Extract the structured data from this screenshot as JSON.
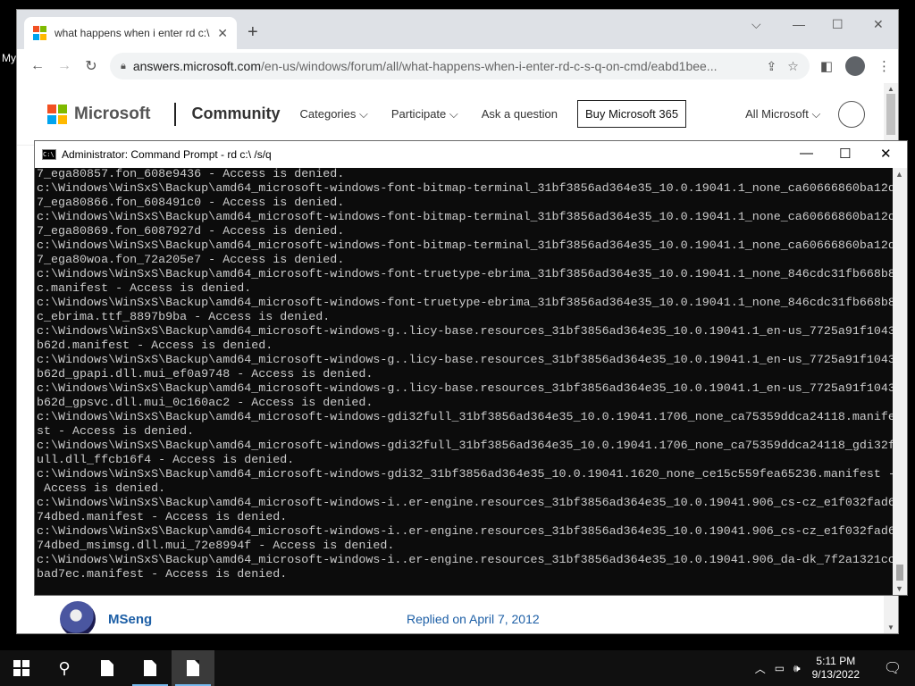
{
  "desktop": {
    "label": "My"
  },
  "browser": {
    "tab_title": "what happens when i enter rd c:\\",
    "tab_close": "✕",
    "new_tab": "+",
    "url_host": "answers.microsoft.com",
    "url_path": "/en-us/windows/forum/all/what-happens-when-i-enter-rd-c-s-q-on-cmd/eabd1bee...",
    "brand_colors": {
      "red": "#f25022",
      "green": "#7fba00",
      "blue": "#00a4ef",
      "yellow": "#ffb900"
    }
  },
  "page": {
    "logo_text": "Microsoft",
    "community": "Community",
    "menu": [
      "Categories ⌵",
      "Participate ⌵",
      "Ask a question"
    ],
    "buy_button": "Buy Microsoft 365",
    "all_microsoft": "All Microsoft ⌵",
    "reply": {
      "name": "MSeng",
      "date": "Replied on April 7, 2012"
    }
  },
  "cmd": {
    "title": "Administrator: Command Prompt - rd  c:\\ /s/q",
    "lines": [
      "7_ega80857.fon_608e9436 - Access is denied.",
      "c:\\Windows\\WinSxS\\Backup\\amd64_microsoft-windows-font-bitmap-terminal_31bf3856ad364e35_10.0.19041.1_none_ca60666860ba12d",
      "7_ega80866.fon_608491c0 - Access is denied.",
      "c:\\Windows\\WinSxS\\Backup\\amd64_microsoft-windows-font-bitmap-terminal_31bf3856ad364e35_10.0.19041.1_none_ca60666860ba12d",
      "7_ega80869.fon_6087927d - Access is denied.",
      "c:\\Windows\\WinSxS\\Backup\\amd64_microsoft-windows-font-bitmap-terminal_31bf3856ad364e35_10.0.19041.1_none_ca60666860ba12d",
      "7_ega80woa.fon_72a205e7 - Access is denied.",
      "c:\\Windows\\WinSxS\\Backup\\amd64_microsoft-windows-font-truetype-ebrima_31bf3856ad364e35_10.0.19041.1_none_846cdc31fb668b8",
      "c.manifest - Access is denied.",
      "c:\\Windows\\WinSxS\\Backup\\amd64_microsoft-windows-font-truetype-ebrima_31bf3856ad364e35_10.0.19041.1_none_846cdc31fb668b8",
      "c_ebrima.ttf_8897b9ba - Access is denied.",
      "c:\\Windows\\WinSxS\\Backup\\amd64_microsoft-windows-g..licy-base.resources_31bf3856ad364e35_10.0.19041.1_en-us_7725a91f1043",
      "b62d.manifest - Access is denied.",
      "c:\\Windows\\WinSxS\\Backup\\amd64_microsoft-windows-g..licy-base.resources_31bf3856ad364e35_10.0.19041.1_en-us_7725a91f1043",
      "b62d_gpapi.dll.mui_ef0a9748 - Access is denied.",
      "c:\\Windows\\WinSxS\\Backup\\amd64_microsoft-windows-g..licy-base.resources_31bf3856ad364e35_10.0.19041.1_en-us_7725a91f1043",
      "b62d_gpsvc.dll.mui_0c160ac2 - Access is denied.",
      "c:\\Windows\\WinSxS\\Backup\\amd64_microsoft-windows-gdi32full_31bf3856ad364e35_10.0.19041.1706_none_ca75359ddca24118.manife",
      "st - Access is denied.",
      "c:\\Windows\\WinSxS\\Backup\\amd64_microsoft-windows-gdi32full_31bf3856ad364e35_10.0.19041.1706_none_ca75359ddca24118_gdi32f",
      "ull.dll_ffcb16f4 - Access is denied.",
      "c:\\Windows\\WinSxS\\Backup\\amd64_microsoft-windows-gdi32_31bf3856ad364e35_10.0.19041.1620_none_ce15c559fea65236.manifest -",
      " Access is denied.",
      "c:\\Windows\\WinSxS\\Backup\\amd64_microsoft-windows-i..er-engine.resources_31bf3856ad364e35_10.0.19041.906_cs-cz_e1f032fad6",
      "74dbed.manifest - Access is denied.",
      "c:\\Windows\\WinSxS\\Backup\\amd64_microsoft-windows-i..er-engine.resources_31bf3856ad364e35_10.0.19041.906_cs-cz_e1f032fad6",
      "74dbed_msimsg.dll.mui_72e8994f - Access is denied.",
      "c:\\Windows\\WinSxS\\Backup\\amd64_microsoft-windows-i..er-engine.resources_31bf3856ad364e35_10.0.19041.906_da-dk_7f2a1321cc",
      "bad7ec.manifest - Access is denied."
    ]
  },
  "taskbar": {
    "time": "5:11 PM",
    "date": "9/13/2022",
    "accent": "#76b9ed"
  }
}
